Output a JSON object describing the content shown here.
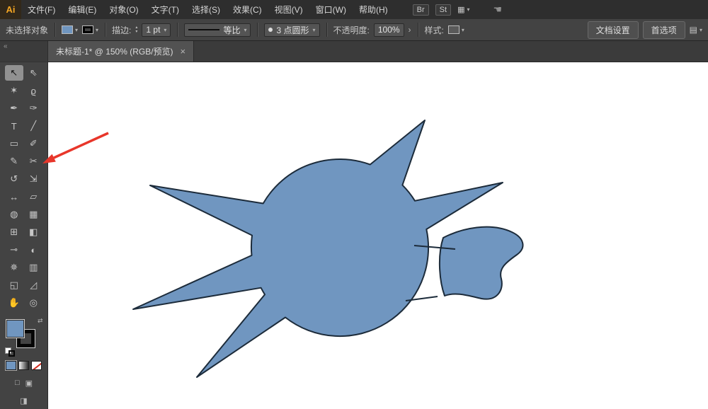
{
  "menubar": {
    "logo": "Ai",
    "items": [
      {
        "label": "文件(F)"
      },
      {
        "label": "编辑(E)"
      },
      {
        "label": "对象(O)"
      },
      {
        "label": "文字(T)"
      },
      {
        "label": "选择(S)"
      },
      {
        "label": "效果(C)"
      },
      {
        "label": "视图(V)"
      },
      {
        "label": "窗口(W)"
      },
      {
        "label": "帮助(H)"
      }
    ],
    "right": {
      "bridge": "Br",
      "stock": "St",
      "arrange_icon": "▦",
      "arrange_caret": "▾",
      "hand_icon": "☚"
    }
  },
  "controlbar": {
    "selection_status": "未选择对象",
    "fill_caret": "▾",
    "stroke_caret": "▾",
    "stroke_label": "描边:",
    "stepper_up": "▴",
    "stepper_down": "▾",
    "stroke_value": "1 pt",
    "stroke_field_caret": "▾",
    "profile_value": "等比",
    "profile_caret": "▾",
    "brush_bullet": "•",
    "brush_value": "3 点圆形",
    "brush_caret": "▾",
    "opacity_label": "不透明度:",
    "opacity_value": "100%",
    "opacity_chevron": "›",
    "style_label": "样式:",
    "style_caret": "▾",
    "doc_setup_button": "文档设置",
    "preferences_button": "首选项",
    "panel_icon": "▤",
    "panel_caret": "▾"
  },
  "tabbar": {
    "title": "未标题-1* @ 150% (RGB/预览)",
    "close": "×"
  },
  "toolbar": {
    "collapse_icon": "«",
    "swap_icon": "⇄",
    "draw_normal_icon": "□",
    "draw_behind_icon": "▣",
    "screen_mode_icon": "◨",
    "tools": [
      {
        "name": "selection-tool",
        "glyph": "↖",
        "active": true
      },
      {
        "name": "direct-selection-tool",
        "glyph": "⇖"
      },
      {
        "name": "magic-wand-tool",
        "glyph": "✶"
      },
      {
        "name": "lasso-tool",
        "glyph": "ϱ"
      },
      {
        "name": "pen-tool",
        "glyph": "✒"
      },
      {
        "name": "curvature-tool",
        "glyph": "✑"
      },
      {
        "name": "type-tool",
        "glyph": "T"
      },
      {
        "name": "line-tool",
        "glyph": "╱"
      },
      {
        "name": "rectangle-tool",
        "glyph": "▭"
      },
      {
        "name": "paintbrush-tool",
        "glyph": "✐"
      },
      {
        "name": "pencil-tool",
        "glyph": "✎"
      },
      {
        "name": "scissors-tool",
        "glyph": "✂"
      },
      {
        "name": "rotate-tool",
        "glyph": "↺"
      },
      {
        "name": "scale-tool",
        "glyph": "⇲"
      },
      {
        "name": "width-tool",
        "glyph": "↔"
      },
      {
        "name": "free-transform-tool",
        "glyph": "▱"
      },
      {
        "name": "shape-builder-tool",
        "glyph": "◍"
      },
      {
        "name": "perspective-grid-tool",
        "glyph": "▦"
      },
      {
        "name": "mesh-tool",
        "glyph": "⊞"
      },
      {
        "name": "gradient-tool",
        "glyph": "◧"
      },
      {
        "name": "eyedropper-tool",
        "glyph": "⊸"
      },
      {
        "name": "blend-tool",
        "glyph": "◐"
      },
      {
        "name": "symbol-sprayer-tool",
        "glyph": "✵"
      },
      {
        "name": "column-graph-tool",
        "glyph": "▥"
      },
      {
        "name": "artboard-tool",
        "glyph": "◱"
      },
      {
        "name": "slice-tool",
        "glyph": "◿"
      },
      {
        "name": "hand-tool",
        "glyph": "✋"
      },
      {
        "name": "zoom-tool",
        "glyph": "◎"
      }
    ]
  },
  "canvas": {
    "zoom_level": "150%",
    "fill_color": "#7096c0",
    "stroke_color": "#1c2b3a",
    "annotation_arrow_color": "#e8362a"
  }
}
